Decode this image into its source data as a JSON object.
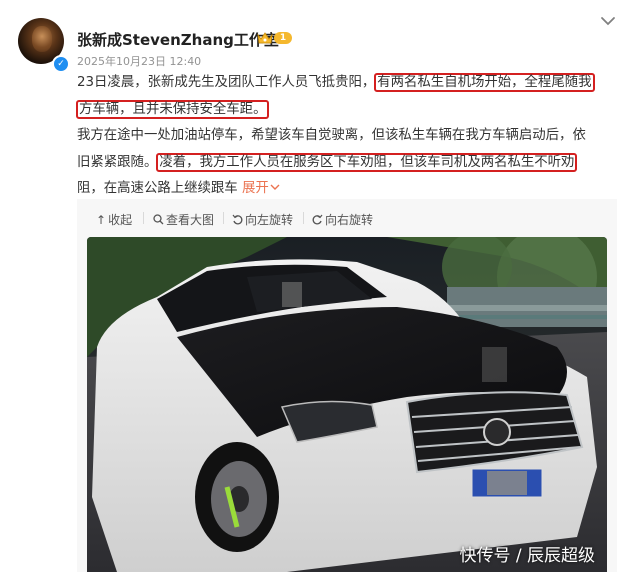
{
  "post": {
    "author": "张新成StevenZhang工作室",
    "vip_level": "1",
    "timestamp": "2025年10月23日 12:40",
    "text_lines": [
      {
        "before": "23日凌晨，张新成先生及团队工作人员飞抵贵阳，",
        "highlight": "有两名私生自机场开始，全程尾随我",
        "after": ""
      },
      {
        "before": "",
        "highlight": "方车辆，且并未保持安全车距。",
        "after": ""
      },
      {
        "before": "我方在途中一处加油站停车，希望该车自觉驶离，但该私生车辆在我方车辆启动后，依",
        "highlight": "",
        "after": ""
      },
      {
        "before": "旧紧紧跟随。",
        "highlight": "凌着，我方工作人员在服务区下车劝阻，但该车司机及两名私生不听劝",
        "after": ""
      },
      {
        "before": "阻，在高速公路上继续跟车",
        "highlight": "",
        "after": ""
      }
    ],
    "expand_label": "展开"
  },
  "toolbar": {
    "collapse": "收起",
    "view_large": "查看大图",
    "rotate_left": "向左旋转",
    "rotate_right": "向右旋转"
  },
  "photo": {
    "watermark": "快传号 / 辰辰超级"
  },
  "colors": {
    "highlight_border": "#d42020",
    "link": "#eb7350",
    "verified": "#1f8ef1",
    "vip": "#f5b82e"
  }
}
